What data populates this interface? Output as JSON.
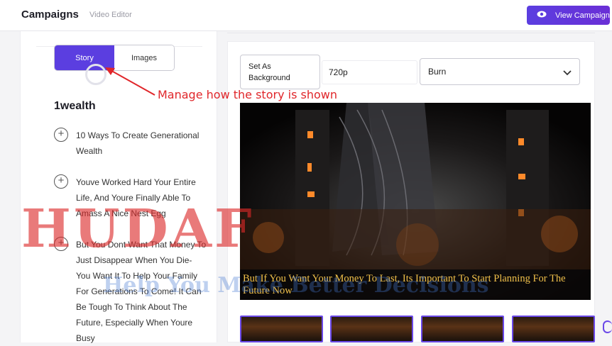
{
  "header": {
    "title": "Campaigns",
    "subtitle": "Video Editor",
    "view_button_label": "View Campaign"
  },
  "left_panel": {
    "tabs": [
      {
        "label": "Story",
        "active": true
      },
      {
        "label": "Images",
        "active": false
      }
    ],
    "story_title": "1wealth",
    "items": [
      {
        "text": "10 Ways To Create Generational Wealth"
      },
      {
        "text": "Youve Worked Hard Your Entire Life, And Youre Finally Able To Amass A Nice Nest Egg"
      },
      {
        "text": "But You Dont Want That Money To Just Disappear When You Die- You Want It To Help Your Family For Generations To Come! It Can Be Tough To Think About The Future, Especially When Youre Busy"
      }
    ]
  },
  "annotation": {
    "text": "Manage how the story is shown",
    "color": "#e0262a"
  },
  "watermark": {
    "main": "HUDAF",
    "sub": "Help You Make Better Decisions"
  },
  "toolbar": {
    "set_background_label": "Set As Background",
    "resolution_value": "720p",
    "transition_value": "Burn"
  },
  "video": {
    "caption": "But If You Want Your Money To Last, Its Important To Start Planning For The Future Now"
  },
  "colors": {
    "accent": "#5b3ee0",
    "caption": "#f0c04a"
  }
}
